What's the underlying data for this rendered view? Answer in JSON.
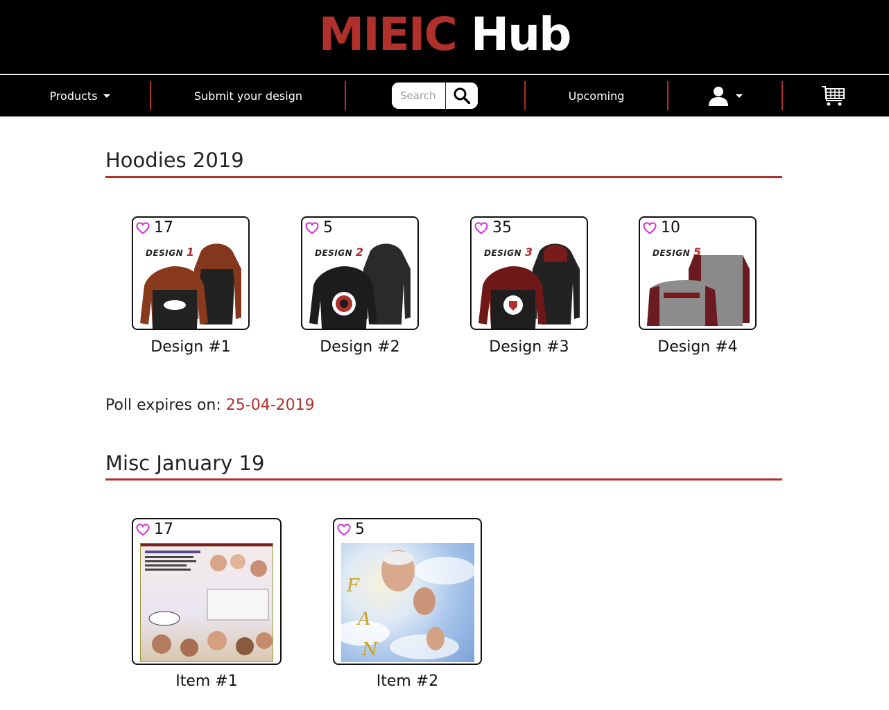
{
  "header": {
    "logo_part1": "MIEIC",
    "logo_part2": "Hub"
  },
  "nav": {
    "products": "Products",
    "submit": "Submit your design",
    "search_placeholder": "Search",
    "upcoming": "Upcoming"
  },
  "sections": [
    {
      "title": "Hoodies 2019",
      "items": [
        {
          "likes": "17",
          "label": "Design #1",
          "tag_text": "DESIGN",
          "tag_num": "1"
        },
        {
          "likes": "5",
          "label": "Design #2",
          "tag_text": "DESIGN",
          "tag_num": "2"
        },
        {
          "likes": "35",
          "label": "Design #3",
          "tag_text": "DESIGN",
          "tag_num": "3"
        },
        {
          "likes": "10",
          "label": "Design #4",
          "tag_text": "DESIGN",
          "tag_num": "5"
        }
      ],
      "poll_label": "Poll expires on: ",
      "poll_date": "25-04-2019"
    },
    {
      "title": "Misc January 19",
      "items": [
        {
          "likes": "17",
          "label": "Item #1"
        },
        {
          "likes": "5",
          "label": "Item #2"
        }
      ]
    }
  ],
  "icons": {
    "heart": "heart-icon",
    "search": "search-icon",
    "user": "user-icon",
    "cart": "cart-icon"
  },
  "colors": {
    "accent": "#b0302c",
    "heart": "#d42fd6",
    "navbar": "#000000"
  }
}
